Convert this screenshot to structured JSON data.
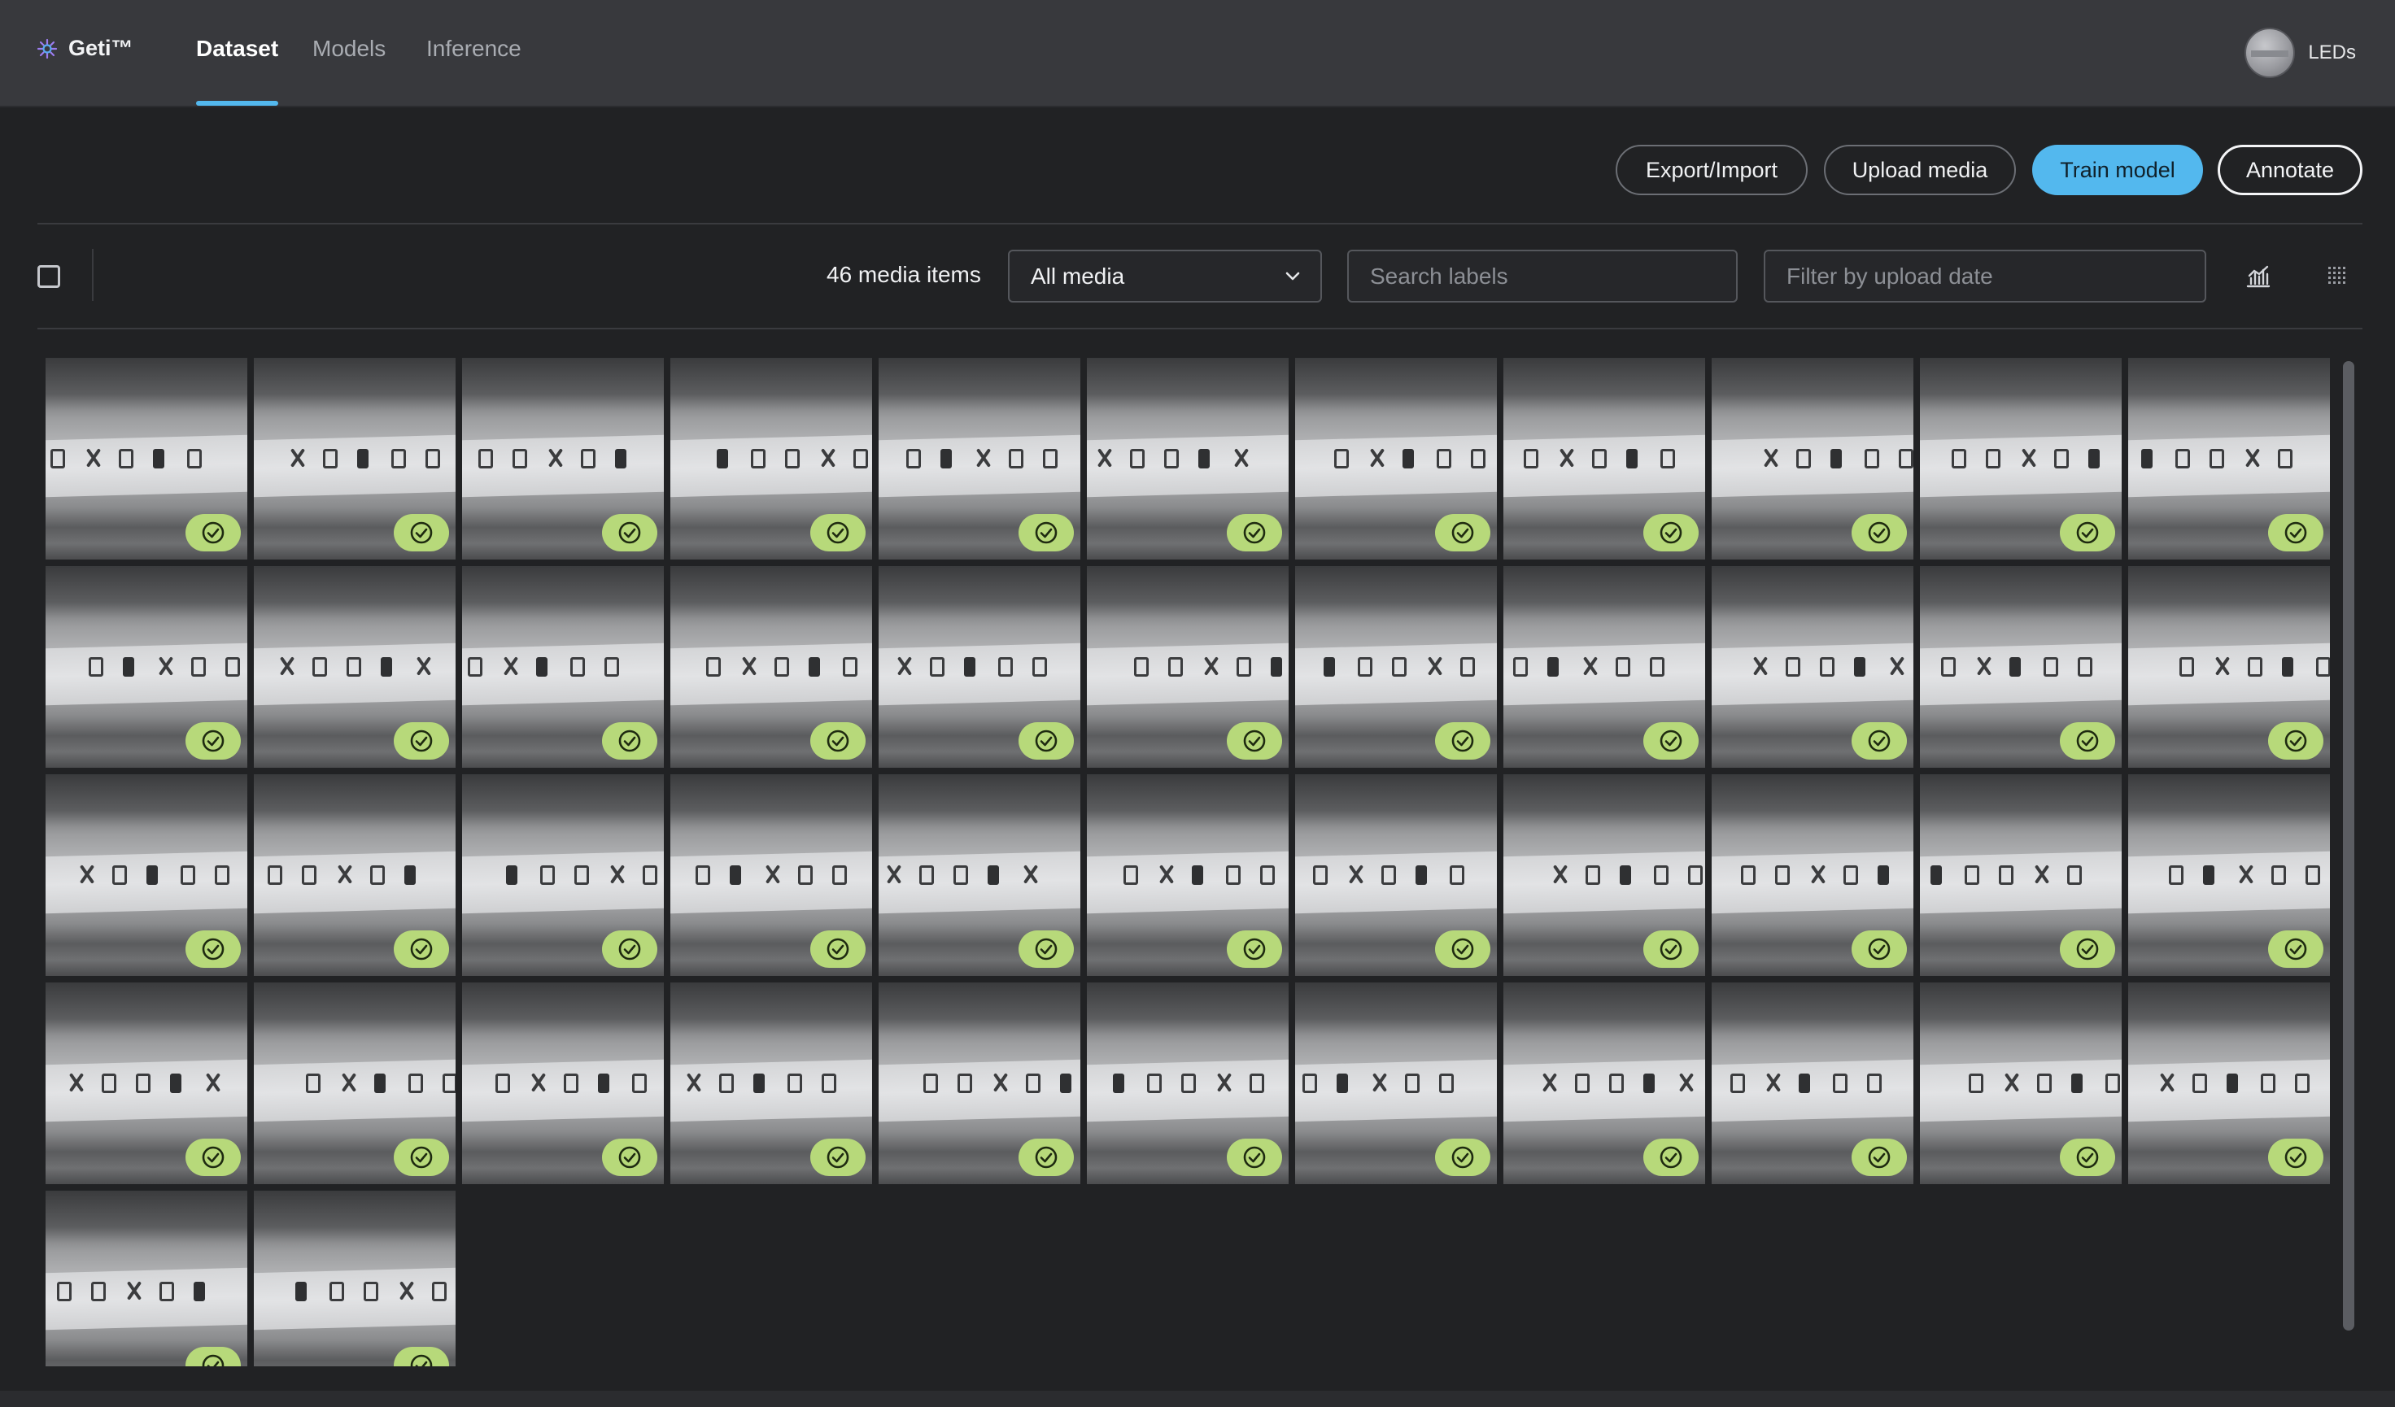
{
  "header": {
    "brand": "Geti™",
    "tabs": [
      {
        "label": "Dataset",
        "active": true
      },
      {
        "label": "Models",
        "active": false
      },
      {
        "label": "Inference",
        "active": false
      }
    ],
    "project_name": "LEDs",
    "accent_color": "#53b8ee"
  },
  "actions": {
    "export_import": "Export/Import",
    "upload_media": "Upload media",
    "train_model": "Train model",
    "annotate": "Annotate"
  },
  "toolbar": {
    "media_count": "46 media items",
    "media_filter": "All media",
    "search_placeholder": "Search labels",
    "date_placeholder": "Filter by upload date",
    "icons": [
      "select-all-checkbox",
      "chart-icon",
      "grid-view-icon"
    ]
  },
  "media": {
    "total": 46,
    "items": [
      {
        "status": "annotated"
      },
      {
        "status": "annotated"
      },
      {
        "status": "annotated"
      },
      {
        "status": "annotated"
      },
      {
        "status": "annotated"
      },
      {
        "status": "annotated"
      },
      {
        "status": "annotated"
      },
      {
        "status": "annotated"
      },
      {
        "status": "annotated"
      },
      {
        "status": "annotated"
      },
      {
        "status": "annotated"
      },
      {
        "status": "annotated"
      },
      {
        "status": "annotated"
      },
      {
        "status": "annotated"
      },
      {
        "status": "annotated"
      },
      {
        "status": "annotated"
      },
      {
        "status": "annotated"
      },
      {
        "status": "annotated"
      },
      {
        "status": "annotated"
      },
      {
        "status": "annotated"
      },
      {
        "status": "annotated"
      },
      {
        "status": "annotated"
      },
      {
        "status": "annotated"
      },
      {
        "status": "annotated"
      },
      {
        "status": "annotated"
      },
      {
        "status": "annotated"
      },
      {
        "status": "annotated"
      },
      {
        "status": "annotated"
      },
      {
        "status": "annotated"
      },
      {
        "status": "annotated"
      },
      {
        "status": "annotated"
      },
      {
        "status": "annotated"
      },
      {
        "status": "annotated"
      },
      {
        "status": "annotated"
      },
      {
        "status": "annotated"
      },
      {
        "status": "annotated"
      },
      {
        "status": "annotated"
      },
      {
        "status": "annotated"
      },
      {
        "status": "annotated"
      },
      {
        "status": "annotated"
      },
      {
        "status": "annotated"
      },
      {
        "status": "annotated"
      },
      {
        "status": "annotated"
      },
      {
        "status": "annotated"
      },
      {
        "status": "annotated"
      },
      {
        "status": "annotated"
      }
    ],
    "badge_color": "#b7d97a"
  }
}
